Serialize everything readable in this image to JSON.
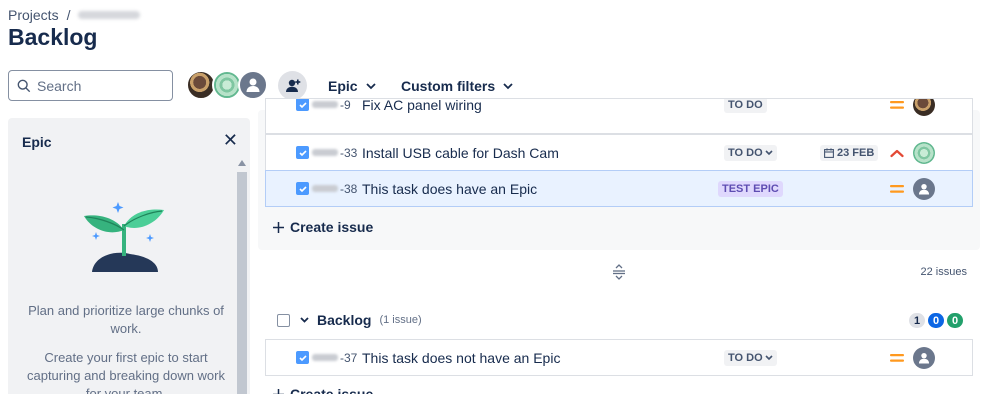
{
  "breadcrumb": {
    "root": "Projects",
    "separator": "/"
  },
  "page": {
    "title": "Backlog"
  },
  "search": {
    "placeholder": "Search"
  },
  "filters": {
    "epic_label": "Epic",
    "custom_label": "Custom filters"
  },
  "epic_panel": {
    "title": "Epic",
    "close_icon": "close-icon",
    "description_1": "Plan and prioritize large chunks of work.",
    "description_2": "Create your first epic to start capturing and breaking down work for your team."
  },
  "sprint": {
    "issues": [
      {
        "key_suffix": "-9",
        "summary": "Fix AC panel wiring",
        "status": "TO DO",
        "priority": "medium",
        "assignee": "brown"
      },
      {
        "key_suffix": "-33",
        "summary": "Install USB cable for Dash Cam",
        "status": "TO DO",
        "due": "23 FEB",
        "priority": "high",
        "assignee": "green"
      },
      {
        "key_suffix": "-38",
        "summary": "This task does have an Epic",
        "epic": "TEST EPIC",
        "priority": "medium",
        "assignee": "default"
      }
    ],
    "create_label": "Create issue",
    "issue_count": "22 issues"
  },
  "backlog": {
    "label": "Backlog",
    "count": "(1 issue)",
    "badges": {
      "todo": "1",
      "in_progress": "0",
      "done": "0"
    },
    "issues": [
      {
        "key_suffix": "-37",
        "summary": "This task does not have an Epic",
        "status": "TO DO",
        "priority": "medium",
        "assignee": "default"
      }
    ],
    "create_label": "Create issue"
  },
  "colors": {
    "accent": "#0c66e4",
    "priority_medium": "#ff991f",
    "priority_high": "#e34935",
    "epic_lozenge_bg": "#dfd8fd",
    "epic_lozenge_text": "#5e4db2"
  }
}
